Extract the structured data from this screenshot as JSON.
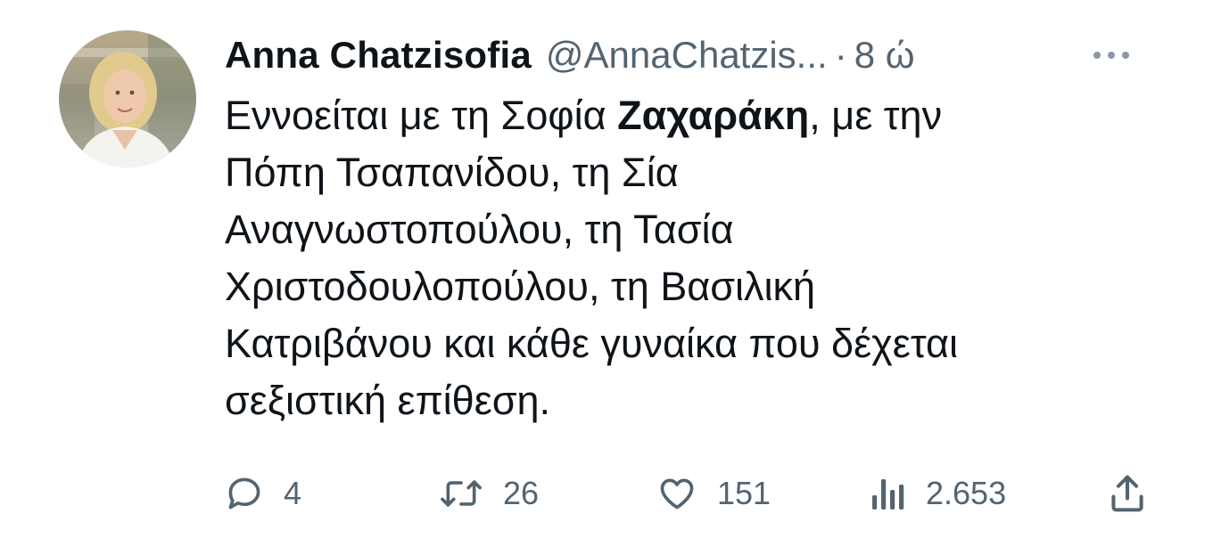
{
  "tweet": {
    "author": {
      "display_name": "Anna Chatzisofia",
      "handle": "@AnnaChatzis...",
      "separator": "·",
      "time": "8 ώ",
      "avatar_icon": "profile-photo"
    },
    "more_icon": "more-dots-icon",
    "body": {
      "line1_pre": "Εννοείται με τη Σοφία ",
      "line1_bold": "Ζαχαράκη",
      "line1_post": ", με την",
      "line2": "Πόπη Τσαπανίδου, τη Σία",
      "line3": "Αναγνωστοπούλου, τη Τασία",
      "line4": "Χριστοδουλοπούλου, τη Βασιλική",
      "line5": "Κατριβάνου και κάθε γυναίκα που δέχεται",
      "line6": "σεξιστική επίθεση."
    },
    "actions": {
      "reply": {
        "icon": "reply-icon",
        "count": "4"
      },
      "retweet": {
        "icon": "retweet-icon",
        "count": "26"
      },
      "like": {
        "icon": "heart-icon",
        "count": "151"
      },
      "views": {
        "icon": "views-icon",
        "count": "2.653"
      },
      "share": {
        "icon": "share-icon"
      }
    },
    "colors": {
      "text": "#0f1419",
      "secondary": "#536471",
      "background": "#ffffff"
    }
  }
}
